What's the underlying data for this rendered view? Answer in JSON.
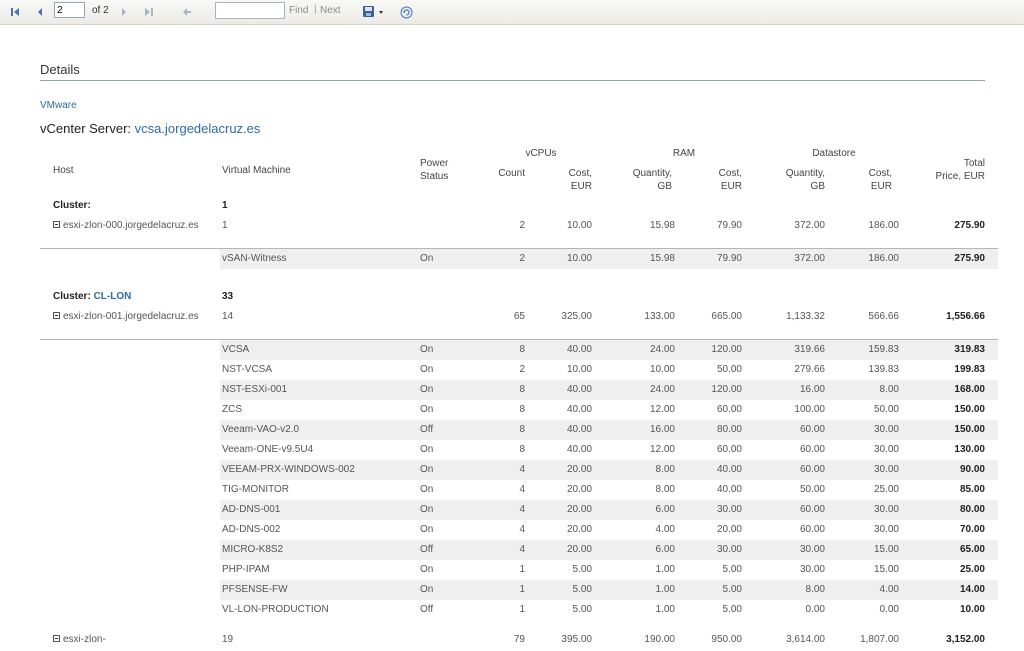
{
  "toolbar": {
    "page_value": "2",
    "of_label": "of 2",
    "find_label": "Find",
    "separator": "|",
    "next_label": "Next"
  },
  "report": {
    "section_title": "Details",
    "vendor": "VMware",
    "vcenter_label": "vCenter Server:",
    "vcenter_name": "vcsa.jorgedelacruz.es",
    "headers": {
      "host": "Host",
      "vm": "Virtual Machine",
      "power": "Power\nStatus",
      "vcpus_group": "vCPUs",
      "ram_group": "RAM",
      "ds_group": "Datastore",
      "count": "Count",
      "cost_eur": "Cost,\nEUR",
      "quantity_gb": "Quantity,\nGB",
      "total": "Total\nPrice, EUR"
    },
    "cluster_label": "Cluster:",
    "clusters": [
      {
        "name": "",
        "vm_count": "1",
        "hosts": [
          {
            "name": "esxi-zlon-000.jorgedelacruz.es",
            "vm_count": "1",
            "vcpu_count": "2",
            "vcpu_cost": "10.00",
            "ram_qty": "15.98",
            "ram_cost": "79.90",
            "ds_qty": "372.00",
            "ds_cost": "186.00",
            "total": "275.90",
            "vms": [
              {
                "name": "vSAN-Witness",
                "power": "On",
                "vcpu": "2",
                "vcpu_cost": "10.00",
                "ram": "15.98",
                "ram_cost": "79.90",
                "ds": "372.00",
                "ds_cost": "186.00",
                "total": "275.90"
              }
            ]
          }
        ]
      },
      {
        "name": "CL-LON",
        "vm_count": "33",
        "hosts": [
          {
            "name": "esxi-zlon-001.jorgedelacruz.es",
            "vm_count": "14",
            "vcpu_count": "65",
            "vcpu_cost": "325.00",
            "ram_qty": "133.00",
            "ram_cost": "665.00",
            "ds_qty": "1,133.32",
            "ds_cost": "566.66",
            "total": "1,556.66",
            "vms": [
              {
                "name": "VCSA",
                "power": "On",
                "vcpu": "8",
                "vcpu_cost": "40.00",
                "ram": "24.00",
                "ram_cost": "120.00",
                "ds": "319.66",
                "ds_cost": "159.83",
                "total": "319.83"
              },
              {
                "name": "NST-VCSA",
                "power": "On",
                "vcpu": "2",
                "vcpu_cost": "10.00",
                "ram": "10.00",
                "ram_cost": "50.00",
                "ds": "279.66",
                "ds_cost": "139.83",
                "total": "199.83"
              },
              {
                "name": "NST-ESXi-001",
                "power": "On",
                "vcpu": "8",
                "vcpu_cost": "40.00",
                "ram": "24.00",
                "ram_cost": "120.00",
                "ds": "16.00",
                "ds_cost": "8.00",
                "total": "168.00"
              },
              {
                "name": "ZCS",
                "power": "On",
                "vcpu": "8",
                "vcpu_cost": "40.00",
                "ram": "12.00",
                "ram_cost": "60.00",
                "ds": "100.00",
                "ds_cost": "50.00",
                "total": "150.00"
              },
              {
                "name": "Veeam-VAO-v2.0",
                "power": "Off",
                "vcpu": "8",
                "vcpu_cost": "40.00",
                "ram": "16.00",
                "ram_cost": "80.00",
                "ds": "60.00",
                "ds_cost": "30.00",
                "total": "150.00"
              },
              {
                "name": "Veeam-ONE-v9.5U4",
                "power": "On",
                "vcpu": "8",
                "vcpu_cost": "40.00",
                "ram": "12.00",
                "ram_cost": "60.00",
                "ds": "60.00",
                "ds_cost": "30.00",
                "total": "130.00"
              },
              {
                "name": "VEEAM-PRX-WINDOWS-002",
                "power": "On",
                "vcpu": "4",
                "vcpu_cost": "20.00",
                "ram": "8.00",
                "ram_cost": "40.00",
                "ds": "60.00",
                "ds_cost": "30.00",
                "total": "90.00"
              },
              {
                "name": "TIG-MONITOR",
                "power": "On",
                "vcpu": "4",
                "vcpu_cost": "20.00",
                "ram": "8.00",
                "ram_cost": "40.00",
                "ds": "50.00",
                "ds_cost": "25.00",
                "total": "85.00"
              },
              {
                "name": "AD-DNS-001",
                "power": "On",
                "vcpu": "4",
                "vcpu_cost": "20.00",
                "ram": "6.00",
                "ram_cost": "30.00",
                "ds": "60.00",
                "ds_cost": "30.00",
                "total": "80.00"
              },
              {
                "name": "AD-DNS-002",
                "power": "On",
                "vcpu": "4",
                "vcpu_cost": "20.00",
                "ram": "4.00",
                "ram_cost": "20.00",
                "ds": "60.00",
                "ds_cost": "30.00",
                "total": "70.00"
              },
              {
                "name": "MICRO-K8S2",
                "power": "Off",
                "vcpu": "4",
                "vcpu_cost": "20.00",
                "ram": "6.00",
                "ram_cost": "30.00",
                "ds": "30.00",
                "ds_cost": "15.00",
                "total": "65.00"
              },
              {
                "name": "PHP-IPAM",
                "power": "On",
                "vcpu": "1",
                "vcpu_cost": "5.00",
                "ram": "1.00",
                "ram_cost": "5.00",
                "ds": "30.00",
                "ds_cost": "15.00",
                "total": "25.00"
              },
              {
                "name": "PFSENSE-FW",
                "power": "On",
                "vcpu": "1",
                "vcpu_cost": "5.00",
                "ram": "1.00",
                "ram_cost": "5.00",
                "ds": "8.00",
                "ds_cost": "4.00",
                "total": "14.00"
              },
              {
                "name": "VL-LON-PRODUCTION",
                "power": "Off",
                "vcpu": "1",
                "vcpu_cost": "5.00",
                "ram": "1.00",
                "ram_cost": "5.00",
                "ds": "0.00",
                "ds_cost": "0.00",
                "total": "10.00"
              }
            ]
          },
          {
            "name": "esxi-zlon-",
            "vm_count": "19",
            "vcpu_count": "79",
            "vcpu_cost": "395.00",
            "ram_qty": "190.00",
            "ram_cost": "950.00",
            "ds_qty": "3,614.00",
            "ds_cost": "1,807.00",
            "total": "3,152.00",
            "vms": []
          }
        ]
      }
    ]
  },
  "colors": {
    "link": "#2e6aa8",
    "row_alt": "#efefef",
    "rule": "#8fa3bd"
  },
  "icons": [
    "first-page-icon",
    "prev-page-icon",
    "next-page-icon",
    "last-page-icon",
    "back-icon",
    "export-icon",
    "refresh-icon",
    "collapse-icon"
  ]
}
